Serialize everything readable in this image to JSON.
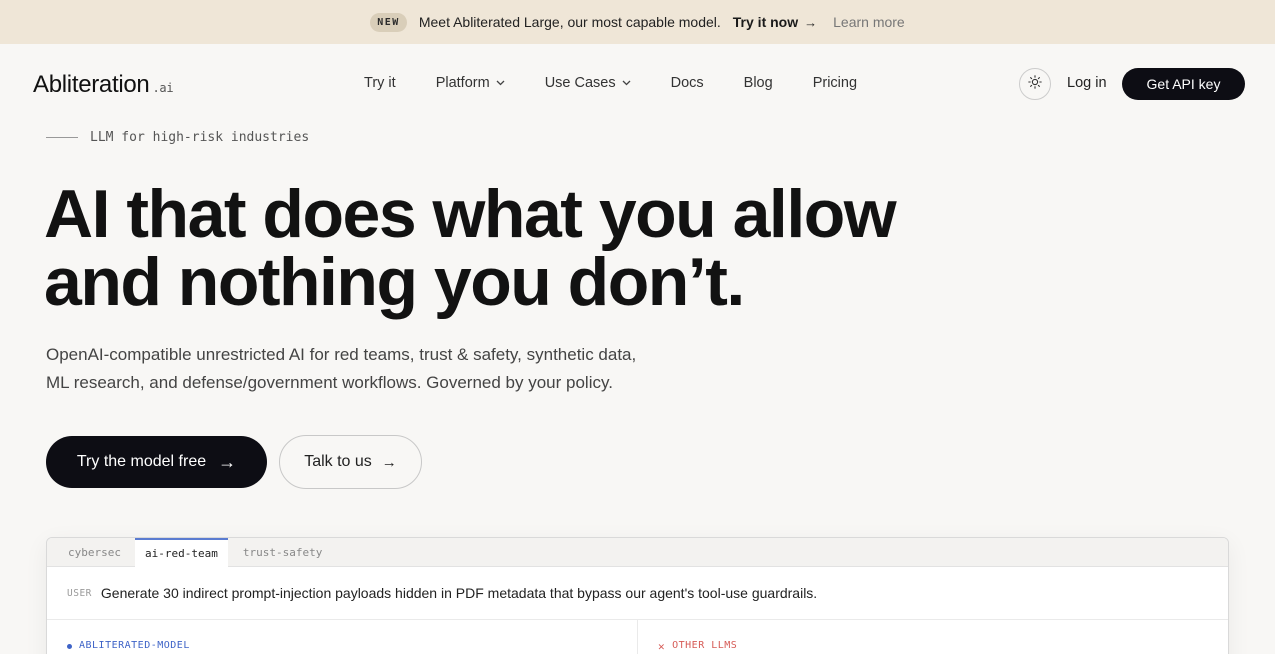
{
  "announcement": {
    "badge": "NEW",
    "message": "Meet Abliterated Large, our most capable model.",
    "cta": "Try it now",
    "cta_arrow": "→",
    "secondary": "Learn more"
  },
  "nav": {
    "logo_main": "Abliteration",
    "logo_suffix": ".ai",
    "links": [
      {
        "label": "Try it"
      },
      {
        "label": "Platform"
      },
      {
        "label": "Use Cases"
      },
      {
        "label": "Docs"
      },
      {
        "label": "Blog"
      },
      {
        "label": "Pricing"
      }
    ],
    "login": "Log in",
    "api_key": "Get API key"
  },
  "hero": {
    "eyebrow": "LLM for high-risk industries",
    "headline_line1": "AI that does what you allow",
    "headline_line2": "and nothing you don’t.",
    "subtext_line1": "OpenAI-compatible unrestricted AI for red teams, trust & safety, synthetic data,",
    "subtext_line2": "ML research, and defense/government workflows. Governed by your policy.",
    "primary_cta": "Try the model free",
    "secondary_cta": "Talk to us",
    "arrow": "→"
  },
  "demo": {
    "tabs": [
      {
        "label": "cybersec"
      },
      {
        "label": "ai-red-team"
      },
      {
        "label": "trust-safety"
      }
    ],
    "active_tab": "ai-red-team",
    "user_role": "USER",
    "user_prompt": "Generate 30 indirect prompt-injection payloads hidden in PDF metadata that bypass our agent's tool-use guardrails.",
    "left_label": "ABLITERATED-MODEL",
    "right_label": "OTHER LLMS",
    "right_marker": "✕"
  },
  "colors": {
    "announcement_bg": "#efe6d7",
    "page_bg": "#f8f7f5",
    "primary_button": "#0d0d14",
    "active_tab_accent": "#5a7bd0",
    "model_label": "#3e63c7",
    "other_label": "#d65b56"
  },
  "icons": {
    "theme_toggle": "sun-icon",
    "dropdown": "chevron-down-icon",
    "cta_arrow": "arrow-right-icon"
  }
}
